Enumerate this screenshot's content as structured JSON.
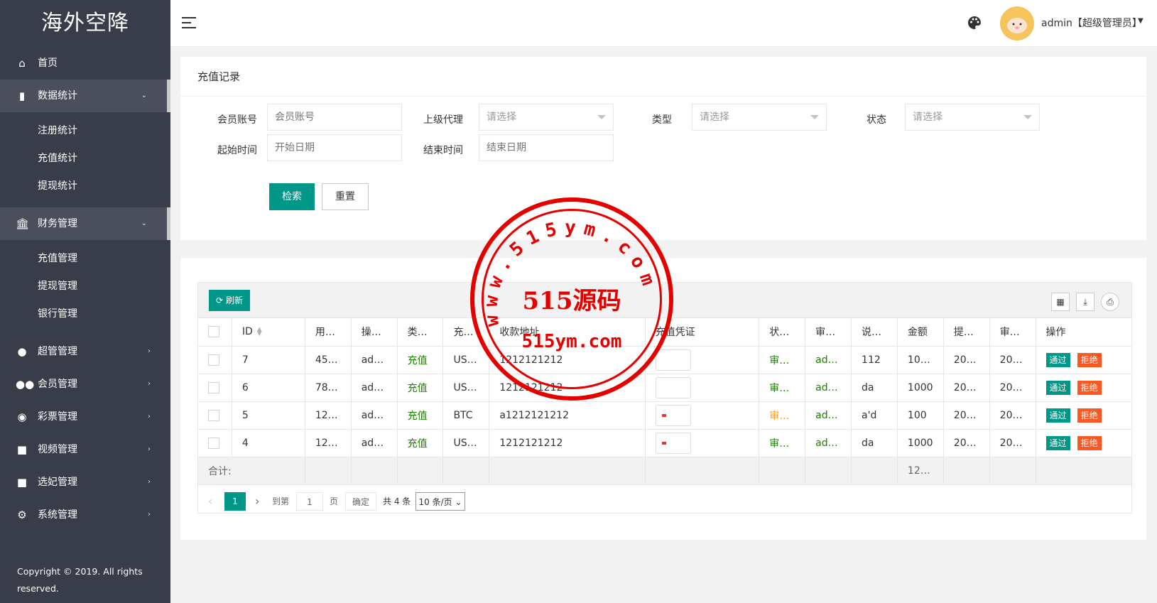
{
  "sidebar": {
    "logo": "海外空降",
    "items": [
      {
        "label": "首页",
        "icon": "home-icon"
      },
      {
        "label": "数据统计",
        "icon": "bar-chart-icon",
        "sub": [
          "注册统计",
          "充值统计",
          "提现统计"
        ]
      },
      {
        "label": "财务管理",
        "icon": "bank-icon",
        "sub": [
          "充值管理",
          "提现管理",
          "银行管理"
        ]
      },
      {
        "label": "超管管理",
        "icon": "user-icon"
      },
      {
        "label": "会员管理",
        "icon": "users-icon"
      },
      {
        "label": "彩票管理",
        "icon": "gamepad-icon"
      },
      {
        "label": "视频管理",
        "icon": "video-icon"
      },
      {
        "label": "选妃管理",
        "icon": "video-icon"
      },
      {
        "label": "系统管理",
        "icon": "gear-icon"
      }
    ],
    "copyright": "Copyright © 2019. All rights reserved."
  },
  "header": {
    "user": "admin【超级管理员】"
  },
  "search": {
    "title": "充值记录",
    "member_label": "会员账号",
    "member_placeholder": "会员账号",
    "agent_label": "上级代理",
    "agent_value": "请选择",
    "type_label": "类型",
    "type_value": "请选择",
    "status_label": "状态",
    "status_value": "请选择",
    "start_label": "起始时间",
    "start_placeholder": "开始日期",
    "end_label": "结束时间",
    "end_placeholder": "结束日期",
    "search_btn": "检索",
    "reset_btn": "重置"
  },
  "table": {
    "refresh": "刷新",
    "columns": [
      "ID",
      "用…",
      "操…",
      "类…",
      "充…",
      "收款地址",
      "充值凭证",
      "状…",
      "审…",
      "说…",
      "金额",
      "提…",
      "审…",
      "操作"
    ],
    "rows": [
      {
        "id": "7",
        "user": "45…",
        "op": "ad…",
        "type": "充值",
        "coin": "US…",
        "addr": "1212121212",
        "voucher": "",
        "status": "审核通过",
        "auditor": "admin",
        "note": "112",
        "amount": "10…",
        "submit": "20…",
        "audit_time": "20…"
      },
      {
        "id": "6",
        "user": "78…",
        "op": "ad…",
        "type": "充值",
        "coin": "US…",
        "addr": "1212121212",
        "voucher": "",
        "status": "审核通过",
        "auditor": "admin",
        "note": "da",
        "amount": "1000",
        "submit": "20…",
        "audit_time": "20…"
      },
      {
        "id": "5",
        "user": "12…",
        "op": "ad…",
        "type": "充值",
        "coin": "BTC",
        "addr": "a1212121212",
        "voucher": "img",
        "status": "审核拒绝",
        "auditor": "admin",
        "note": "a'd",
        "amount": "100",
        "submit": "20…",
        "audit_time": "20…"
      },
      {
        "id": "4",
        "user": "12…",
        "op": "ad…",
        "type": "充值",
        "coin": "US…",
        "addr": "1212121212",
        "voucher": "img",
        "status": "审核通过",
        "auditor": "admin",
        "note": "da",
        "amount": "1000",
        "submit": "20…",
        "audit_time": "20…"
      }
    ],
    "pass": "通过",
    "reject": "拒绝",
    "total_label": "合计:",
    "total_amount": "12…"
  },
  "pager": {
    "current": "1",
    "goto": "到第",
    "page_input": "1",
    "page_unit": "页",
    "confirm": "确定",
    "total": "共 4 条",
    "per_page": "10 条/页"
  },
  "watermark": {
    "url_ring": "www.515ym.com",
    "main": "515源码",
    "url": "515ym.com"
  },
  "colors": {
    "primary": "#009688",
    "danger": "#ff5722",
    "sidebar": "#393d49",
    "stamp": "#e50000"
  }
}
